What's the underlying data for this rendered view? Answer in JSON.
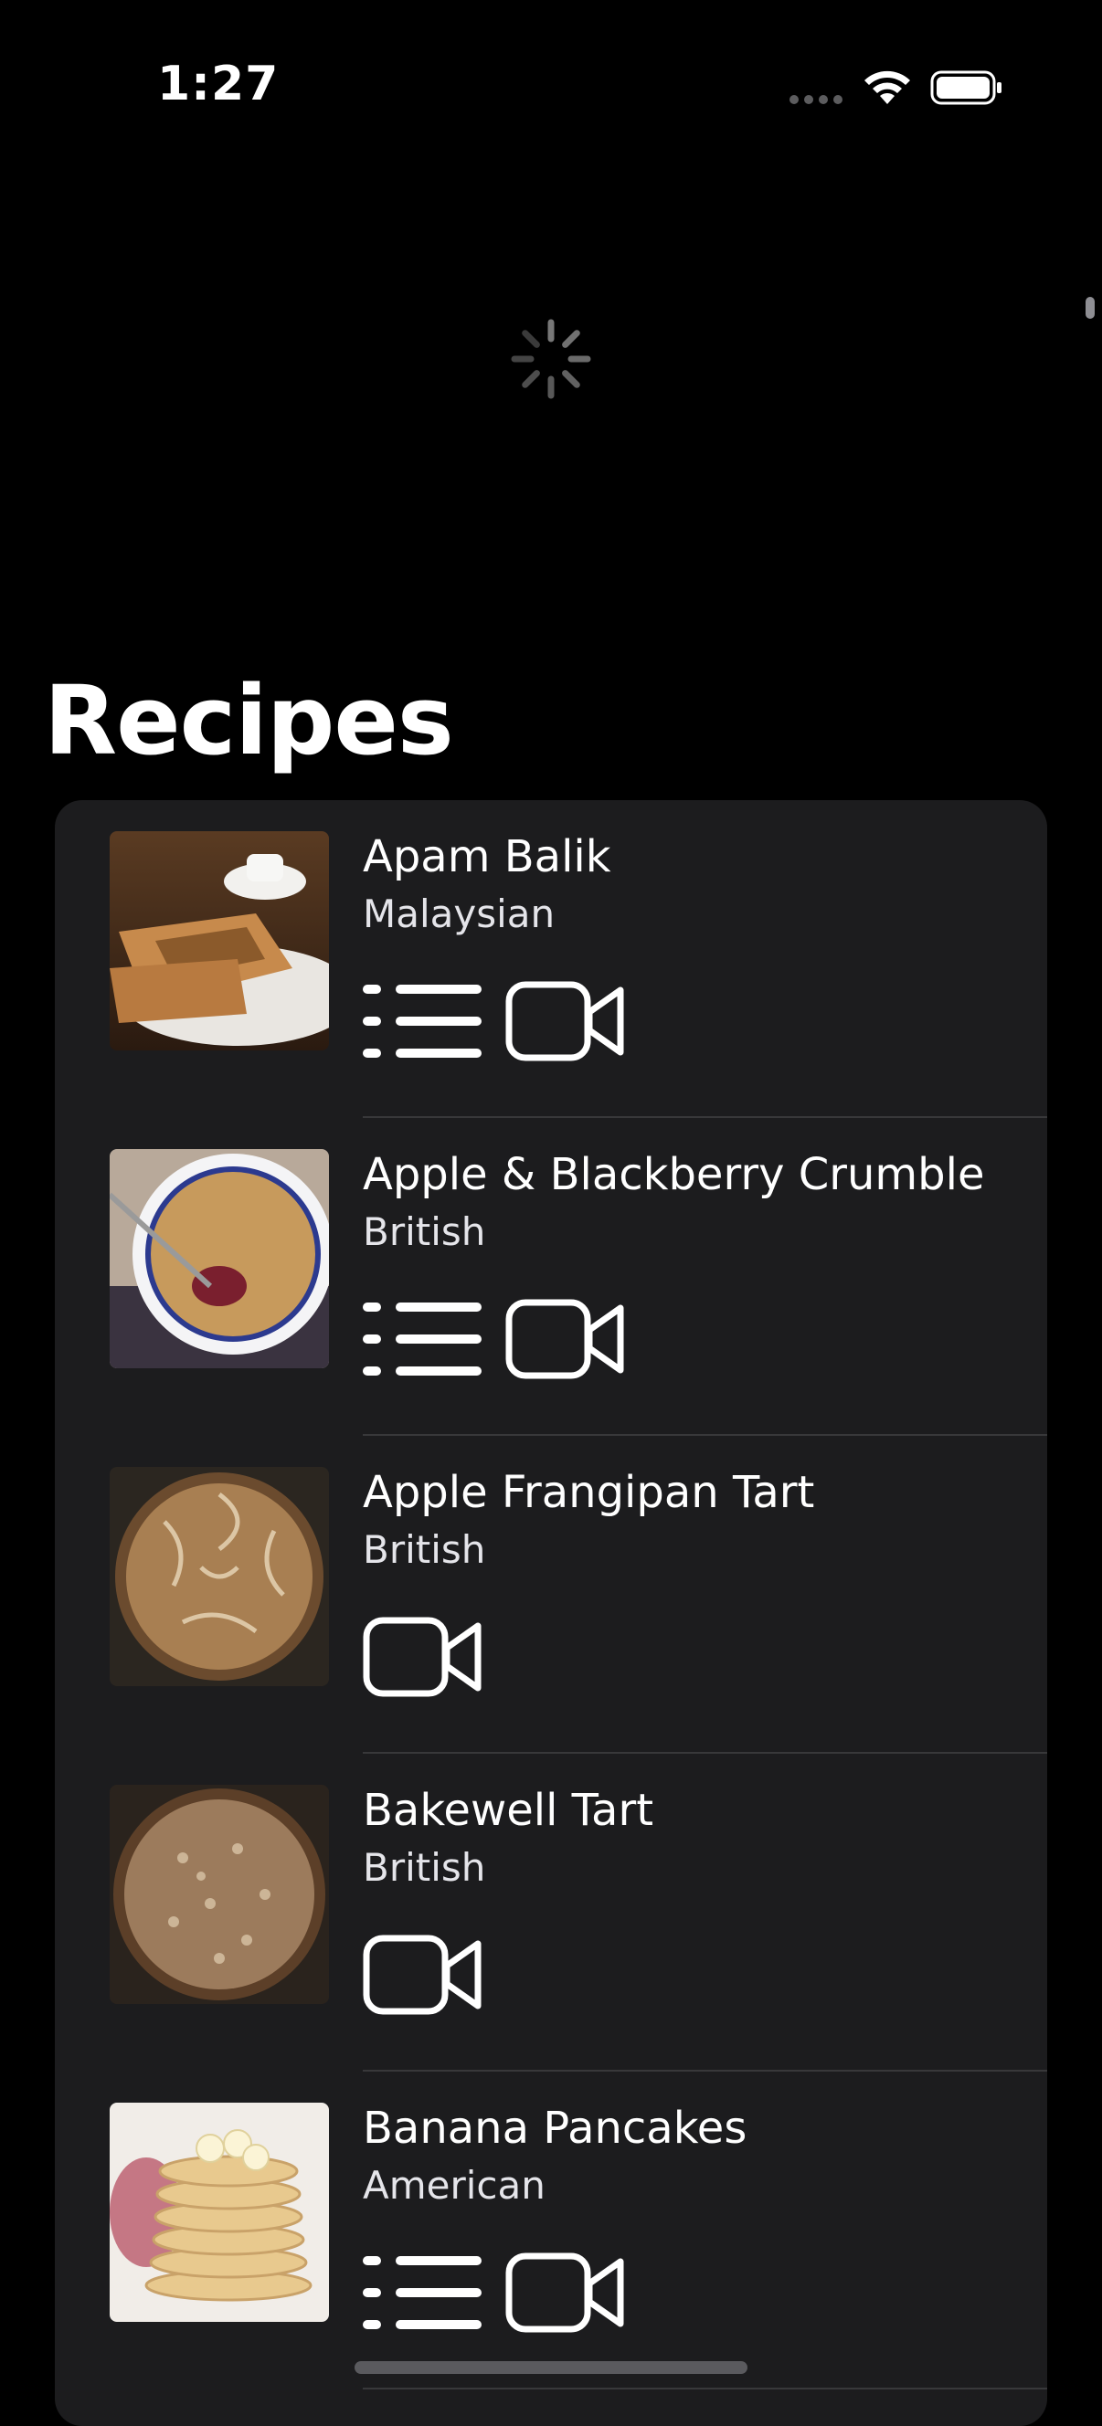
{
  "status_bar": {
    "time": "1:27"
  },
  "header": {
    "title": "Recipes"
  },
  "recipes": [
    {
      "name": "Apam Balik",
      "area": "Malaysian",
      "has_ingredients_list": true,
      "has_video": true
    },
    {
      "name": "Apple & Blackberry Crumble",
      "area": "British",
      "has_ingredients_list": true,
      "has_video": true
    },
    {
      "name": "Apple Frangipan Tart",
      "area": "British",
      "has_ingredients_list": false,
      "has_video": true
    },
    {
      "name": "Bakewell Tart",
      "area": "British",
      "has_ingredients_list": false,
      "has_video": true
    },
    {
      "name": "Banana Pancakes",
      "area": "American",
      "has_ingredients_list": true,
      "has_video": true
    }
  ],
  "icons": {
    "list": "list-icon",
    "video": "video-camera-icon",
    "loading": "activity-spinner-icon"
  },
  "colors": {
    "background": "#000000",
    "card": "#1c1c1e",
    "divider": "#38383a",
    "text_primary": "#ffffff",
    "text_secondary": "#e5e5ea"
  }
}
